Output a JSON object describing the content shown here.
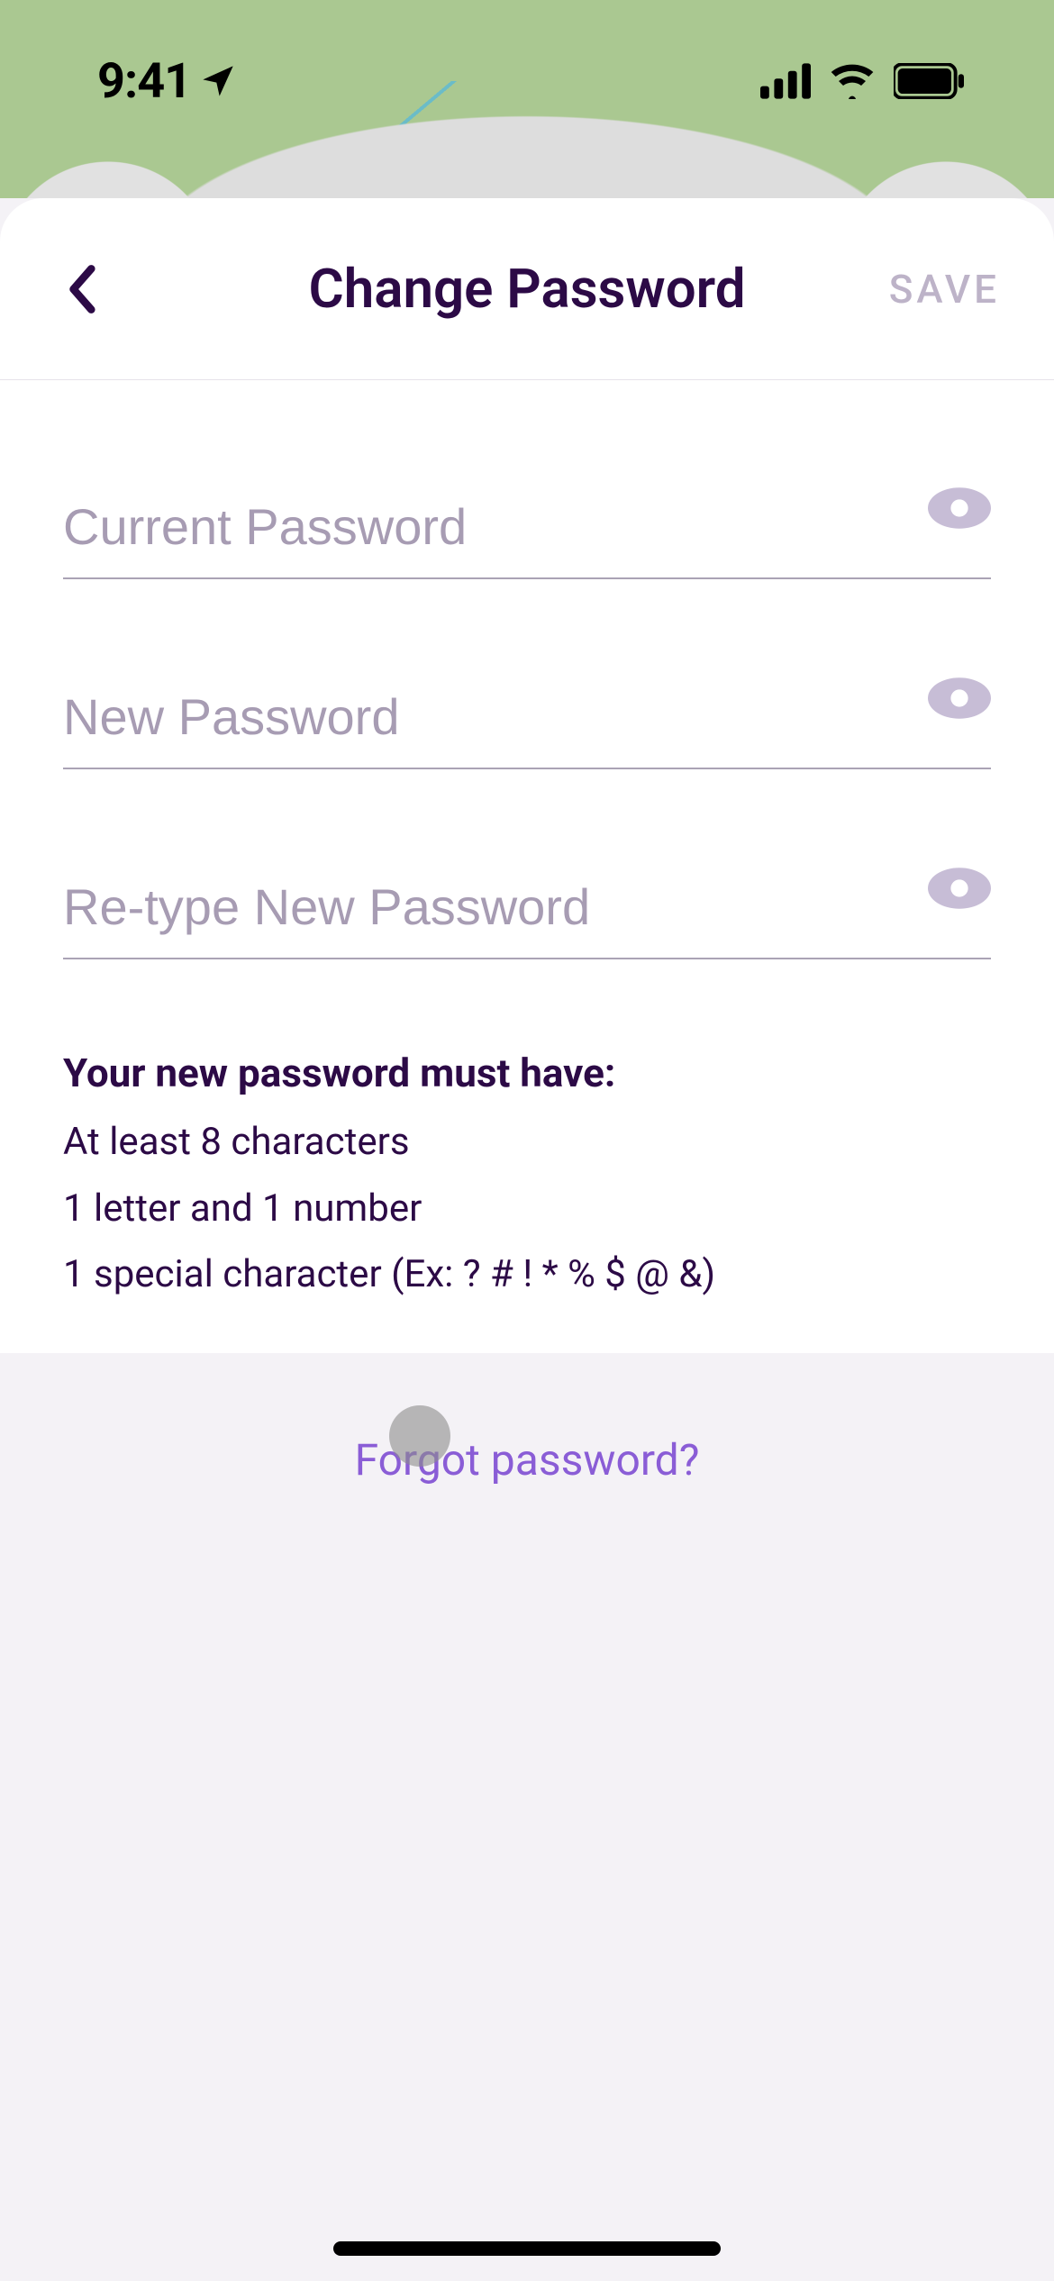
{
  "status": {
    "time": "9:41"
  },
  "header": {
    "title": "Change Password",
    "save": "SAVE"
  },
  "fields": {
    "current": {
      "placeholder": "Current Password"
    },
    "new": {
      "placeholder": "New Password"
    },
    "retype": {
      "placeholder": "Re-type New Password"
    }
  },
  "rules": {
    "title": "Your new password must have:",
    "items": [
      "At least 8 characters",
      "1 letter and 1 number",
      "1 special character (Ex: ? # ! * % $ @ &)"
    ]
  },
  "forgot": "Forgot password?"
}
